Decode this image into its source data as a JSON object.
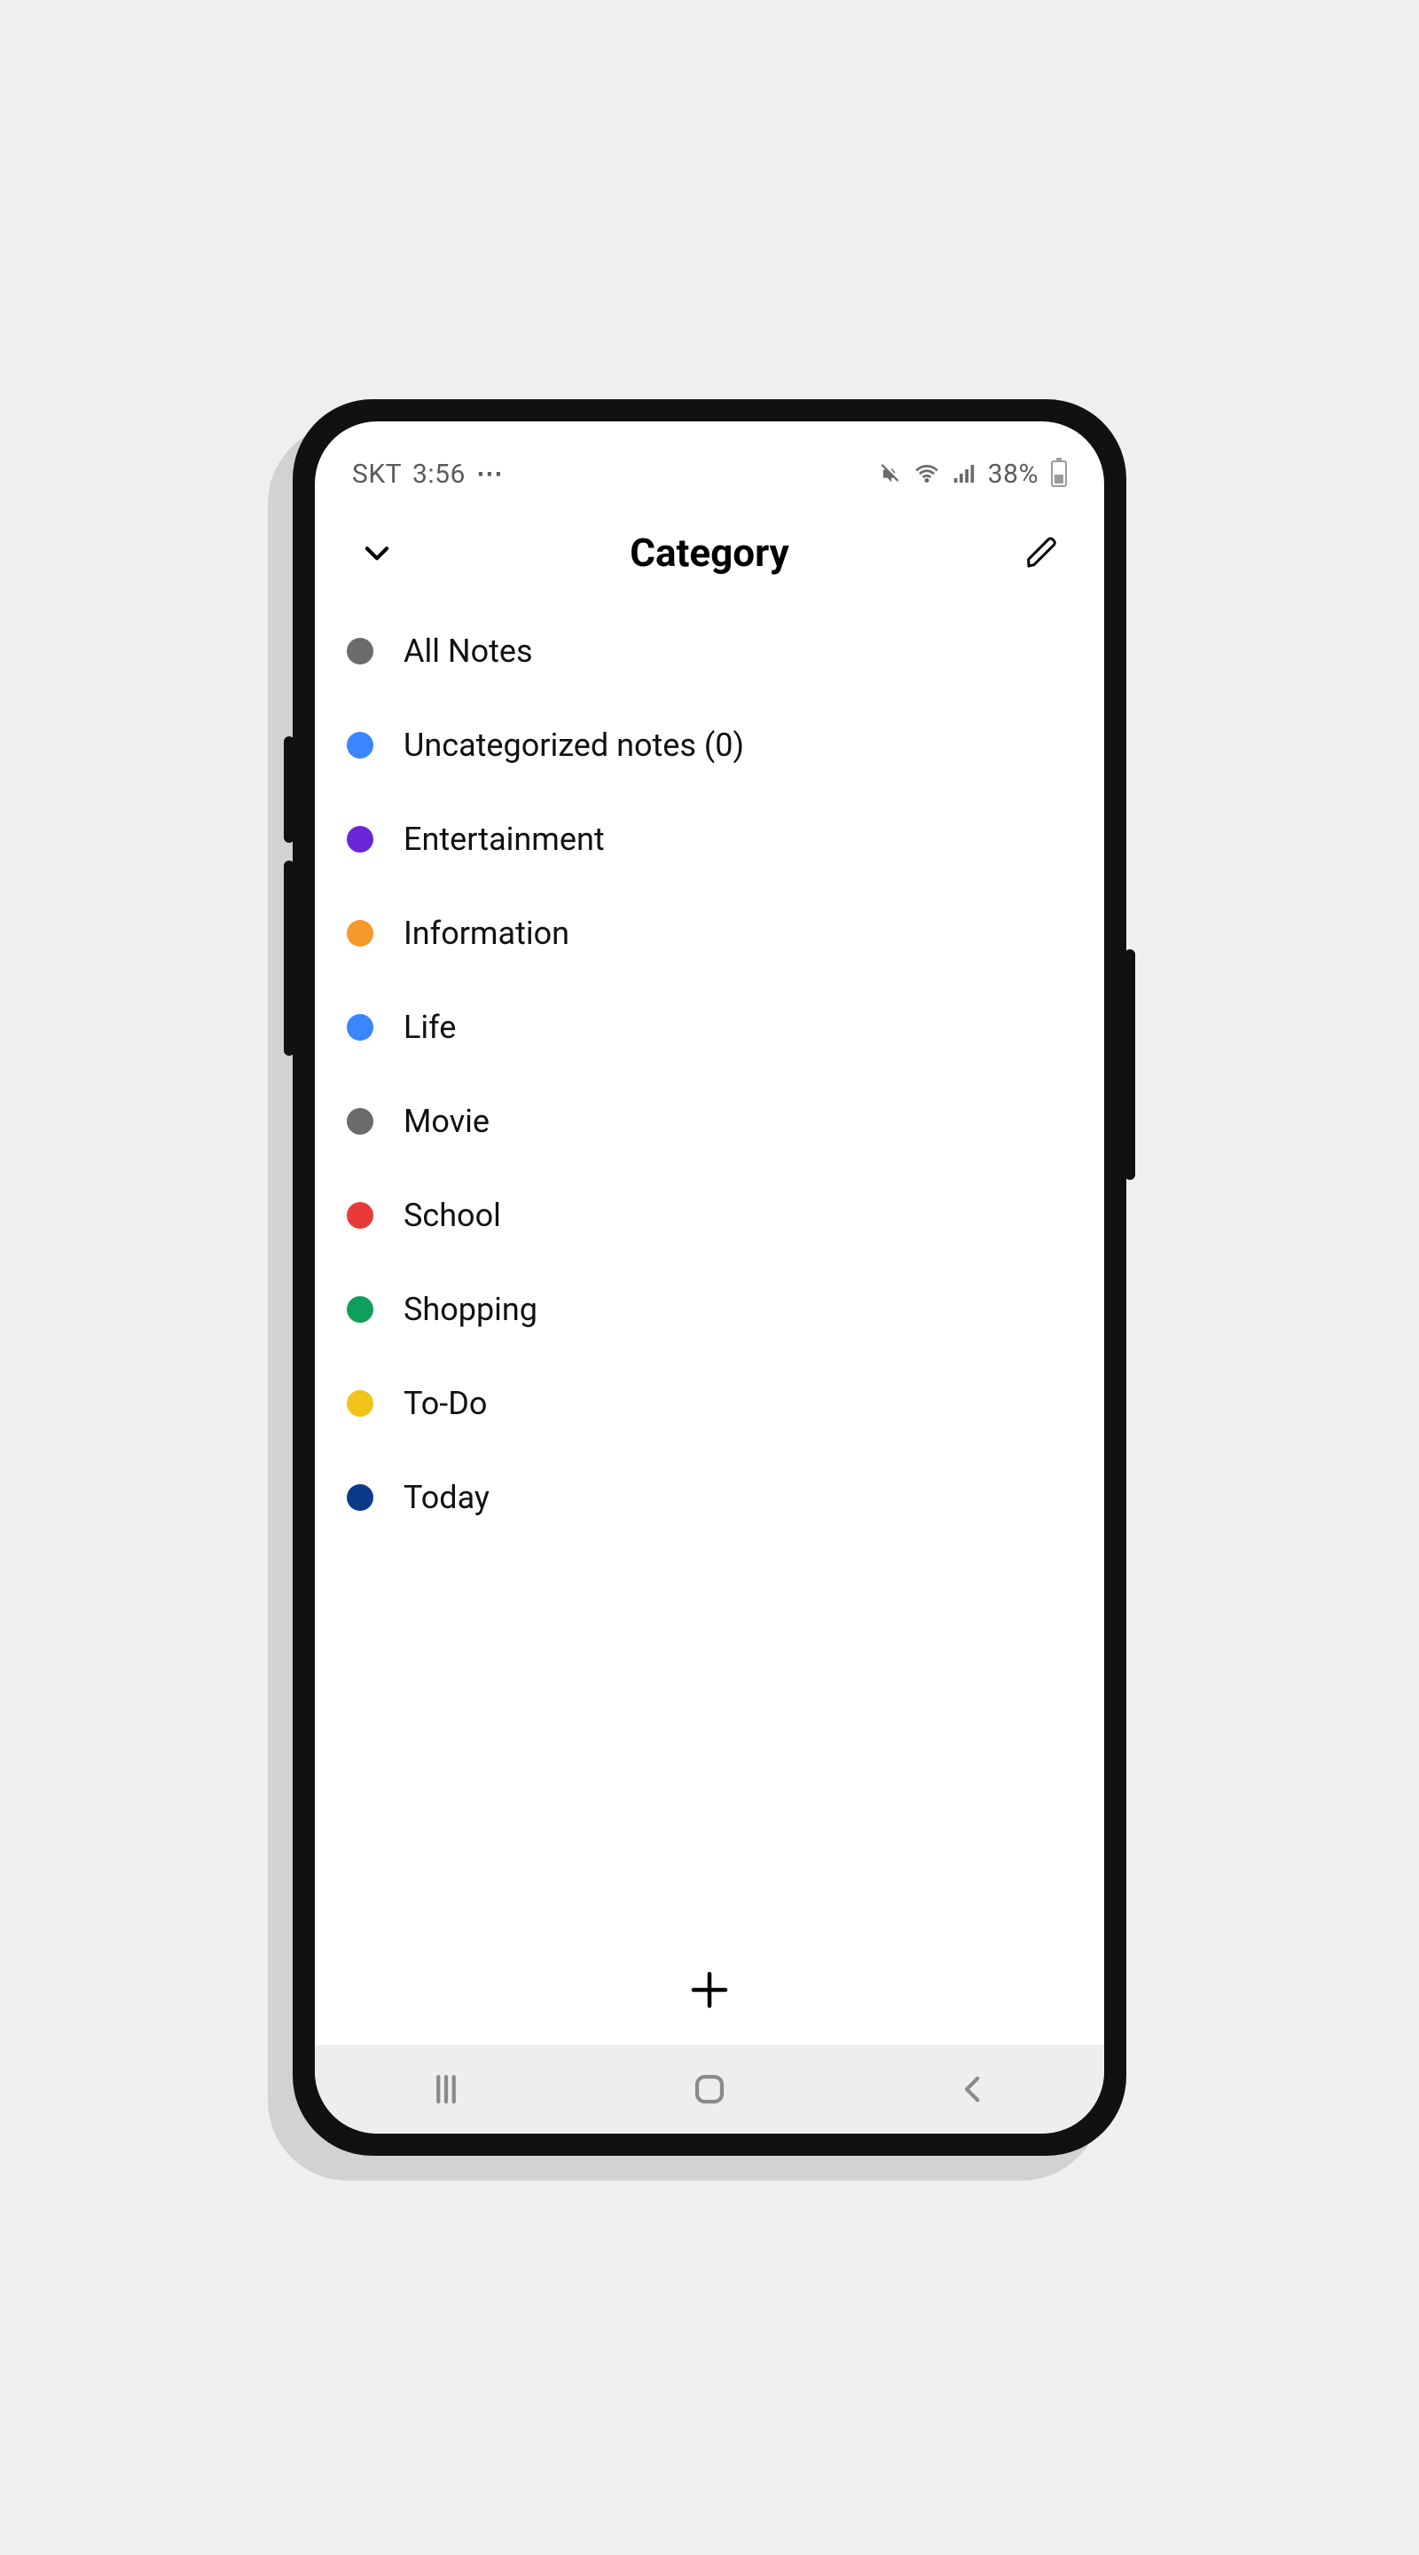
{
  "status": {
    "carrier": "SKT",
    "time": "3:56",
    "battery_pct": "38%"
  },
  "header": {
    "title": "Category"
  },
  "categories": [
    {
      "label": "All Notes",
      "color": "#6b6b6b"
    },
    {
      "label": "Uncategorized notes (0)",
      "color": "#3a86ff"
    },
    {
      "label": "Entertainment",
      "color": "#6a27d8"
    },
    {
      "label": "Information",
      "color": "#f39a2b"
    },
    {
      "label": "Life",
      "color": "#3a86ff"
    },
    {
      "label": "Movie",
      "color": "#6b6b6b"
    },
    {
      "label": "School",
      "color": "#e93a3a"
    },
    {
      "label": "Shopping",
      "color": "#109e5c"
    },
    {
      "label": "To-Do",
      "color": "#f0c419"
    },
    {
      "label": "Today",
      "color": "#0b3a8b"
    }
  ]
}
